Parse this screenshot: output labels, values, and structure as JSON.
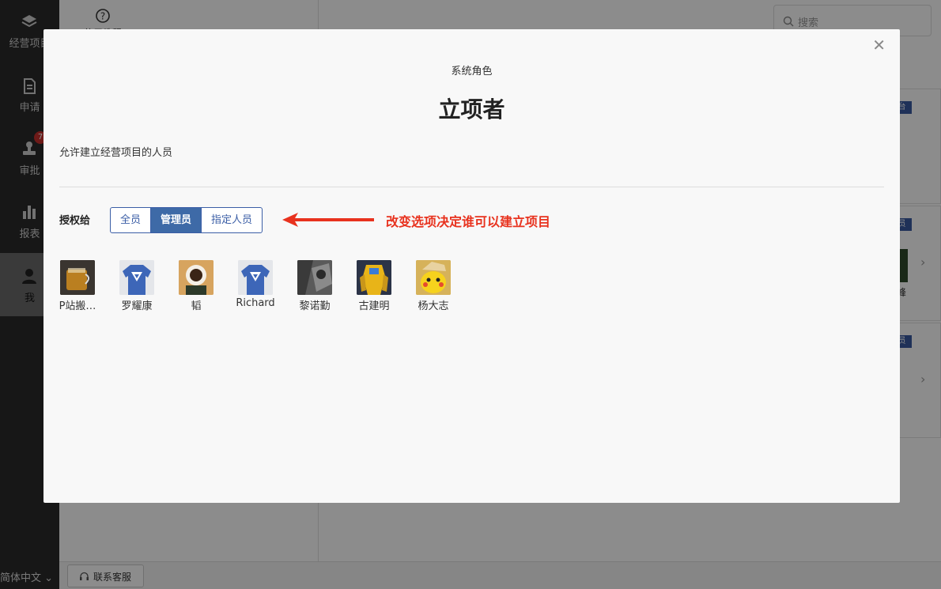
{
  "sidebar": {
    "items": [
      {
        "label": "经营项目",
        "icon": "layers-icon"
      },
      {
        "label": "申请",
        "icon": "document-icon"
      },
      {
        "label": "审批",
        "icon": "stamp-icon",
        "badge": "7"
      },
      {
        "label": "报表",
        "icon": "bar-chart-icon"
      },
      {
        "label": "我",
        "icon": "user-icon"
      }
    ],
    "language": "简体中文"
  },
  "background": {
    "help_label": "使用教程",
    "search_placeholder": "搜索",
    "contact_label": "联系客服",
    "tag_labels": [
      "台",
      "员",
      "员"
    ],
    "partial_name": "峰"
  },
  "modal": {
    "subtitle": "系统角色",
    "title": "立项者",
    "description": "允许建立经营项目的人员",
    "grant_label": "授权给",
    "options": [
      "全员",
      "管理员",
      "指定人员"
    ],
    "selected_option": "管理员",
    "annotation": "改变选项决定谁可以建立项目",
    "annotation_color": "#e8321e",
    "accent_color": "#3e6aa7",
    "members": [
      {
        "name": "P站搬…",
        "avatar": "tea-cup-photo"
      },
      {
        "name": "罗耀康",
        "avatar": "blue-tshirt-photo"
      },
      {
        "name": "韬",
        "avatar": "coffee-photo"
      },
      {
        "name": "Richard",
        "avatar": "blue-tshirt-photo"
      },
      {
        "name": "黎诺勤",
        "avatar": "grayscale-photo"
      },
      {
        "name": "古建明",
        "avatar": "robot-photo"
      },
      {
        "name": "杨大志",
        "avatar": "pikachu-photo"
      }
    ]
  }
}
